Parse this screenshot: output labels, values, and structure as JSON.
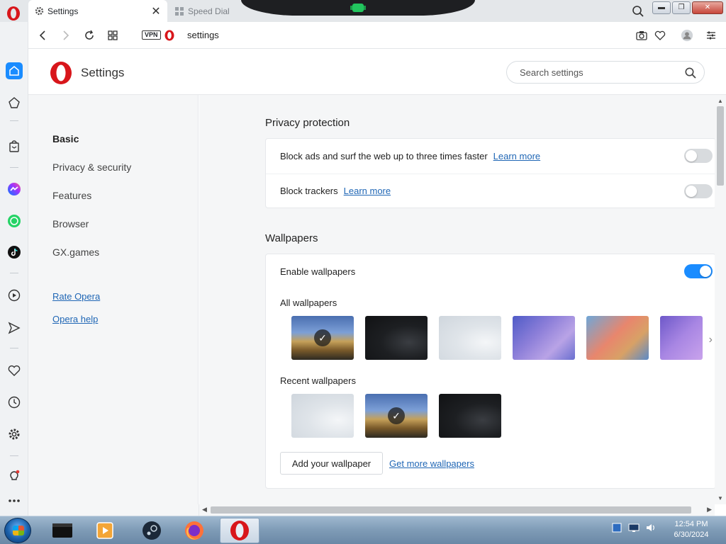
{
  "tabs": [
    {
      "label": "Settings",
      "icon": "gear-icon",
      "active": true
    },
    {
      "label": "Speed Dial",
      "icon": "grid-icon",
      "active": false
    }
  ],
  "address": {
    "vpn_label": "VPN",
    "url": "settings"
  },
  "page": {
    "title": "Settings",
    "search_placeholder": "Search settings"
  },
  "nav": {
    "items": [
      {
        "label": "Basic",
        "active": true
      },
      {
        "label": "Privacy & security"
      },
      {
        "label": "Features"
      },
      {
        "label": "Browser"
      },
      {
        "label": "GX.games"
      }
    ],
    "rate": "Rate Opera",
    "help": "Opera help"
  },
  "privacy": {
    "title": "Privacy protection",
    "rows": [
      {
        "label": "Block ads and surf the web up to three times faster",
        "link": "Learn more",
        "enabled": false
      },
      {
        "label": "Block trackers",
        "link": "Learn more",
        "enabled": false
      }
    ]
  },
  "wallpapers": {
    "title": "Wallpapers",
    "enable_label": "Enable wallpapers",
    "enabled": true,
    "all_label": "All wallpapers",
    "recent_label": "Recent wallpapers",
    "add_button": "Add your wallpaper",
    "more_link": "Get more wallpapers",
    "all_items": [
      "lighthouse",
      "dark-fan",
      "light-fan",
      "purple-waves",
      "sunset-waves",
      "violet-waves"
    ],
    "all_selected": "lighthouse",
    "recent_items": [
      "light-fan",
      "lighthouse",
      "dark-fan"
    ],
    "recent_selected": "lighthouse"
  },
  "taskbar": {
    "time": "12:54 PM",
    "date": "6/30/2024",
    "apps": [
      "terminal-app",
      "media-player-app",
      "steam-app",
      "firefox-app",
      "opera-app"
    ]
  },
  "colors": {
    "accent": "#1a8cff",
    "link": "#1f66b5",
    "opera_red": "#d8161b"
  }
}
